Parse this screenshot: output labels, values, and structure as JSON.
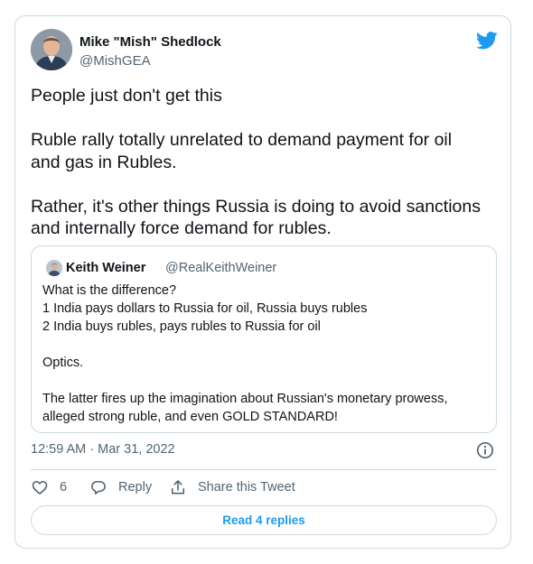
{
  "tweet": {
    "author": {
      "name": "Mike \"Mish\" Shedlock",
      "handle": "@MishGEA"
    },
    "paragraphs": [
      [
        "People just don't get this"
      ],
      [
        "Ruble rally totally unrelated to demand payment for oil",
        "and gas in Rubles."
      ],
      [
        "Rather, it's other things Russia is doing to avoid sanctions",
        "and internally force demand for rubles."
      ]
    ],
    "timestamp": "12:59 AM · Mar 31, 2022",
    "likes": "6",
    "reply_label": "Reply",
    "share_label": "Share this Tweet",
    "read_replies_label": "Read 4 replies"
  },
  "quoted_tweet": {
    "author": {
      "name": "Keith Weiner",
      "handle": "@RealKeithWeiner"
    },
    "lines": [
      "What is the difference?",
      "1 India pays dollars to Russia for oil, Russia buys rubles",
      "2 India buys rubles, pays rubles to Russia for oil",
      "",
      "Optics.",
      "",
      "The latter fires up the imagination about Russian's monetary prowess,",
      "alleged strong ruble, and even GOLD STANDARD!"
    ]
  },
  "icons": {
    "brand": "twitter-bird-icon",
    "info": "info-icon",
    "like": "heart-icon",
    "reply": "reply-bubble-icon",
    "share": "share-icon"
  },
  "colors": {
    "accent": "#1d9bf0",
    "text": "#0f1419",
    "secondary_text": "#536471",
    "border": "#cfd9de"
  }
}
